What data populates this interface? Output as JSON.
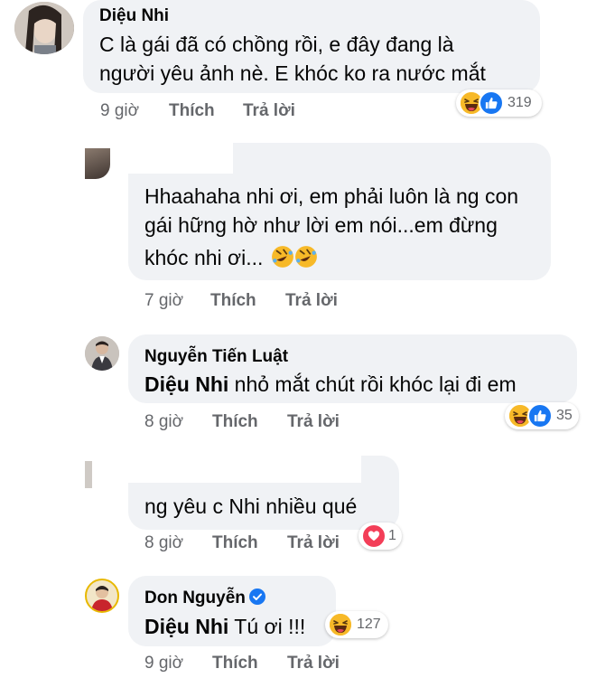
{
  "actions": {
    "like": "Thích",
    "reply": "Trả lời"
  },
  "comments": [
    {
      "author": "Diệu Nhi",
      "lines": [
        "C là gái đã có chồng rồi, e đây đang là",
        "người yêu ảnh nè. E khóc ko ra nước mắt"
      ],
      "time": "9 giờ",
      "reactions": {
        "count": "319",
        "types": [
          "haha",
          "like"
        ]
      }
    },
    {
      "author": "",
      "lines": [
        "Hhaahaha nhi ơi, em phải luôn là ng con",
        "gái hững hờ như lời em nói...em đừng",
        "khóc nhi ơi..."
      ],
      "time": "7 giờ"
    },
    {
      "author": "Nguyễn Tiến Luật",
      "mention": "Diệu Nhi",
      "text": "nhỏ mắt chút rồi khóc lại đi em",
      "time": "8 giờ",
      "reactions": {
        "count": "35",
        "types": [
          "haha",
          "like"
        ]
      }
    },
    {
      "author": "",
      "text": "ng yêu c Nhi nhiều qué",
      "time": "8 giờ",
      "reactions": {
        "count": "1",
        "types": [
          "love"
        ]
      }
    },
    {
      "author": "Don Nguyễn",
      "verified": true,
      "mention": "Diệu Nhi",
      "text": "Tú ơi !!!",
      "time": "9 giờ",
      "reactions": {
        "count": "127",
        "types": [
          "haha"
        ]
      }
    }
  ],
  "colors": {
    "bubble": "#f0f2f5",
    "meta": "#65676b",
    "like_blue": "#1877f2",
    "love_red": "#f33e58",
    "haha_yellow": "#f7b928"
  }
}
